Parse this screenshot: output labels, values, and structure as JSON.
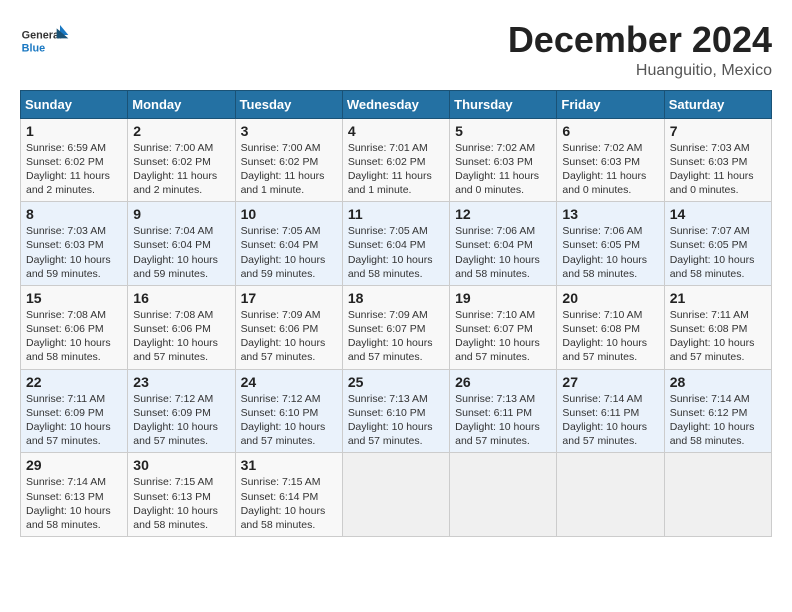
{
  "logo": {
    "general": "General",
    "blue": "Blue"
  },
  "title": "December 2024",
  "subtitle": "Huanguitio, Mexico",
  "weekdays": [
    "Sunday",
    "Monday",
    "Tuesday",
    "Wednesday",
    "Thursday",
    "Friday",
    "Saturday"
  ],
  "weeks": [
    [
      {
        "day": "1",
        "info": "Sunrise: 6:59 AM\nSunset: 6:02 PM\nDaylight: 11 hours and 2 minutes."
      },
      {
        "day": "2",
        "info": "Sunrise: 7:00 AM\nSunset: 6:02 PM\nDaylight: 11 hours and 2 minutes."
      },
      {
        "day": "3",
        "info": "Sunrise: 7:00 AM\nSunset: 6:02 PM\nDaylight: 11 hours and 1 minute."
      },
      {
        "day": "4",
        "info": "Sunrise: 7:01 AM\nSunset: 6:02 PM\nDaylight: 11 hours and 1 minute."
      },
      {
        "day": "5",
        "info": "Sunrise: 7:02 AM\nSunset: 6:03 PM\nDaylight: 11 hours and 0 minutes."
      },
      {
        "day": "6",
        "info": "Sunrise: 7:02 AM\nSunset: 6:03 PM\nDaylight: 11 hours and 0 minutes."
      },
      {
        "day": "7",
        "info": "Sunrise: 7:03 AM\nSunset: 6:03 PM\nDaylight: 11 hours and 0 minutes."
      }
    ],
    [
      {
        "day": "8",
        "info": "Sunrise: 7:03 AM\nSunset: 6:03 PM\nDaylight: 10 hours and 59 minutes."
      },
      {
        "day": "9",
        "info": "Sunrise: 7:04 AM\nSunset: 6:04 PM\nDaylight: 10 hours and 59 minutes."
      },
      {
        "day": "10",
        "info": "Sunrise: 7:05 AM\nSunset: 6:04 PM\nDaylight: 10 hours and 59 minutes."
      },
      {
        "day": "11",
        "info": "Sunrise: 7:05 AM\nSunset: 6:04 PM\nDaylight: 10 hours and 58 minutes."
      },
      {
        "day": "12",
        "info": "Sunrise: 7:06 AM\nSunset: 6:04 PM\nDaylight: 10 hours and 58 minutes."
      },
      {
        "day": "13",
        "info": "Sunrise: 7:06 AM\nSunset: 6:05 PM\nDaylight: 10 hours and 58 minutes."
      },
      {
        "day": "14",
        "info": "Sunrise: 7:07 AM\nSunset: 6:05 PM\nDaylight: 10 hours and 58 minutes."
      }
    ],
    [
      {
        "day": "15",
        "info": "Sunrise: 7:08 AM\nSunset: 6:06 PM\nDaylight: 10 hours and 58 minutes."
      },
      {
        "day": "16",
        "info": "Sunrise: 7:08 AM\nSunset: 6:06 PM\nDaylight: 10 hours and 57 minutes."
      },
      {
        "day": "17",
        "info": "Sunrise: 7:09 AM\nSunset: 6:06 PM\nDaylight: 10 hours and 57 minutes."
      },
      {
        "day": "18",
        "info": "Sunrise: 7:09 AM\nSunset: 6:07 PM\nDaylight: 10 hours and 57 minutes."
      },
      {
        "day": "19",
        "info": "Sunrise: 7:10 AM\nSunset: 6:07 PM\nDaylight: 10 hours and 57 minutes."
      },
      {
        "day": "20",
        "info": "Sunrise: 7:10 AM\nSunset: 6:08 PM\nDaylight: 10 hours and 57 minutes."
      },
      {
        "day": "21",
        "info": "Sunrise: 7:11 AM\nSunset: 6:08 PM\nDaylight: 10 hours and 57 minutes."
      }
    ],
    [
      {
        "day": "22",
        "info": "Sunrise: 7:11 AM\nSunset: 6:09 PM\nDaylight: 10 hours and 57 minutes."
      },
      {
        "day": "23",
        "info": "Sunrise: 7:12 AM\nSunset: 6:09 PM\nDaylight: 10 hours and 57 minutes."
      },
      {
        "day": "24",
        "info": "Sunrise: 7:12 AM\nSunset: 6:10 PM\nDaylight: 10 hours and 57 minutes."
      },
      {
        "day": "25",
        "info": "Sunrise: 7:13 AM\nSunset: 6:10 PM\nDaylight: 10 hours and 57 minutes."
      },
      {
        "day": "26",
        "info": "Sunrise: 7:13 AM\nSunset: 6:11 PM\nDaylight: 10 hours and 57 minutes."
      },
      {
        "day": "27",
        "info": "Sunrise: 7:14 AM\nSunset: 6:11 PM\nDaylight: 10 hours and 57 minutes."
      },
      {
        "day": "28",
        "info": "Sunrise: 7:14 AM\nSunset: 6:12 PM\nDaylight: 10 hours and 58 minutes."
      }
    ],
    [
      {
        "day": "29",
        "info": "Sunrise: 7:14 AM\nSunset: 6:13 PM\nDaylight: 10 hours and 58 minutes."
      },
      {
        "day": "30",
        "info": "Sunrise: 7:15 AM\nSunset: 6:13 PM\nDaylight: 10 hours and 58 minutes."
      },
      {
        "day": "31",
        "info": "Sunrise: 7:15 AM\nSunset: 6:14 PM\nDaylight: 10 hours and 58 minutes."
      },
      null,
      null,
      null,
      null
    ]
  ]
}
